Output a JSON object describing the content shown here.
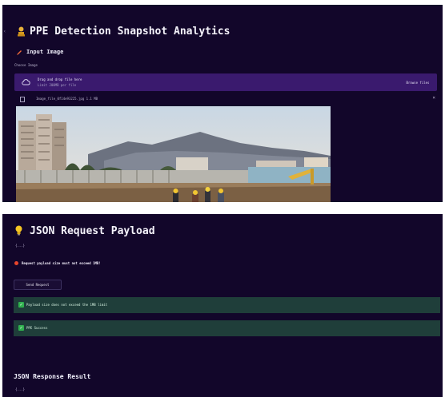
{
  "top": {
    "title": "PPE Detection Snapshot Analytics",
    "section_title": "Input Image",
    "choose_label": "Choose Image",
    "dropzone_text": "Drag and drop file here",
    "dropzone_hint": "Limit 200MB per file",
    "browse_label": "Browse files",
    "file_name": "Image_file_0f14e93225.jpg  1.1 MB",
    "file_close": "×"
  },
  "bottom": {
    "title": "JSON Request Payload",
    "json_toggle": "{...}",
    "warning_text": "Request payload size must not exceed 1MB!",
    "send_label": "Send Request",
    "alerts": [
      "Payload size does not exceed the 1MB limit",
      "PPE Success"
    ],
    "response_title": "JSON Response Result",
    "response_toggle": "{...}"
  }
}
